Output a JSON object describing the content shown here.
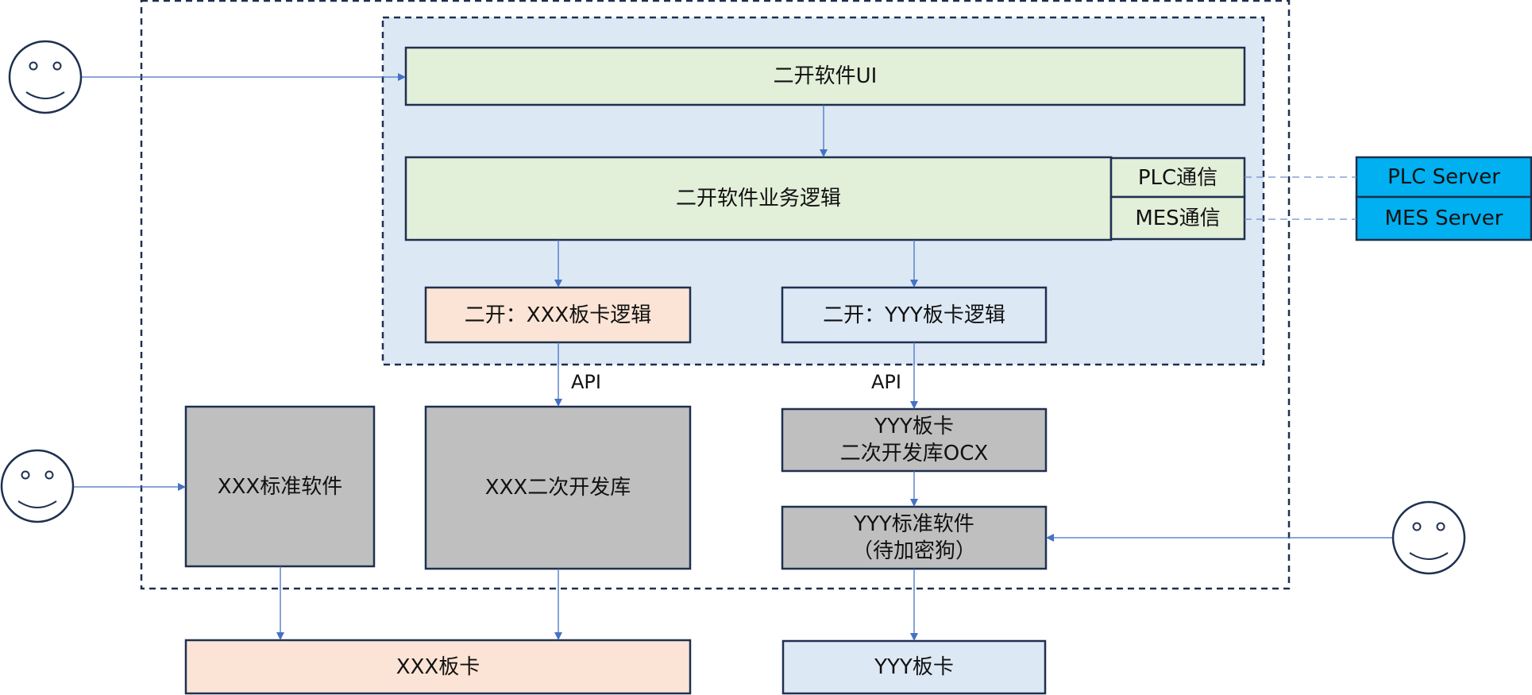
{
  "colors": {
    "border": "#1f3050",
    "arrow": "#4472c4",
    "container_fill": "#dde8f5",
    "software_fill": "#e2efd9",
    "xxx_fill": "#fbe4d5",
    "vendor_fill": "#bfbfbf",
    "yyy_fill": "#dde8f5",
    "server_fill": "#00b0f0"
  },
  "nodes": {
    "ui": "二开软件UI",
    "business": "二开软件业务逻辑",
    "plc_comm": "PLC通信",
    "mes_comm": "MES通信",
    "plc_server": "PLC Server",
    "mes_server": "MES Server",
    "xxx_logic": "二开：XXX板卡逻辑",
    "yyy_logic": "二开：YYY板卡逻辑",
    "xxx_std": "XXX标准软件",
    "xxx_lib": "XXX二次开发库",
    "yyy_ocx": "YYY板卡\n二次开发库OCX",
    "yyy_std": "YYY标准软件\n（待加密狗）",
    "xxx_card": "XXX板卡",
    "yyy_card": "YYY板卡"
  },
  "edge_labels": {
    "api_xxx": "API",
    "api_yyy": "API"
  },
  "actors": [
    {
      "name": "user-top-left"
    },
    {
      "name": "user-mid-left"
    },
    {
      "name": "user-right"
    }
  ]
}
